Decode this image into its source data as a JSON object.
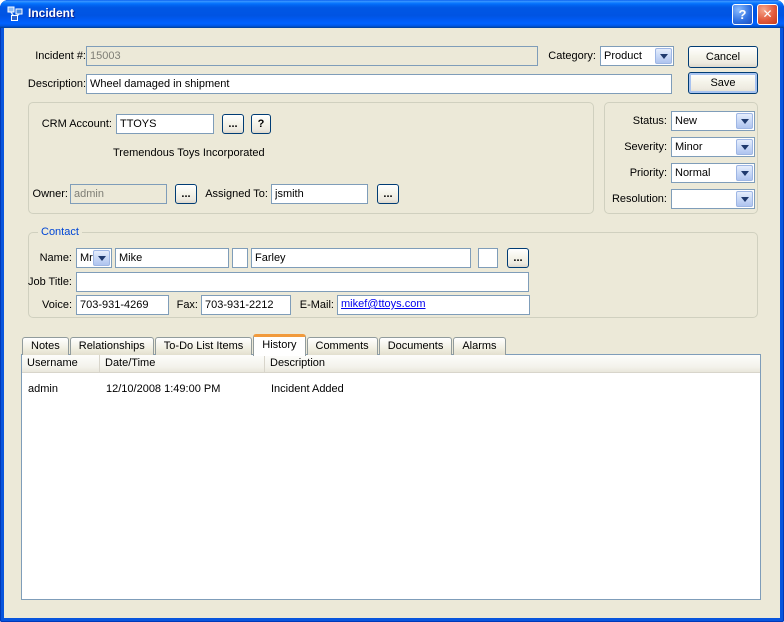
{
  "window": {
    "title": "Incident",
    "help_label": "?",
    "close_label": "✕"
  },
  "colors": {
    "titlebar_blue": "#0054E3",
    "tab_accent_orange": "#F19A3C",
    "link_blue": "#0000EE",
    "dialog_bg": "#ECE9D8"
  },
  "form": {
    "incident_label": "Incident #:",
    "incident_value": "15003",
    "category_label": "Category:",
    "category_value": "Product",
    "description_label": "Description:",
    "description_value": "Wheel damaged in shipment",
    "cancel_label": "Cancel",
    "save_label": "Save"
  },
  "crm": {
    "account_label": "CRM Account:",
    "account_value": "TTOYS",
    "browse_label": "...",
    "help_label": "?",
    "account_display_name": "Tremendous Toys Incorporated",
    "owner_label": "Owner:",
    "owner_value": "admin",
    "owner_browse_label": "...",
    "assigned_label": "Assigned To:",
    "assigned_value": "jsmith",
    "assigned_browse_label": "..."
  },
  "status_panel": {
    "status_label": "Status:",
    "status_value": "New",
    "severity_label": "Severity:",
    "severity_value": "Minor",
    "priority_label": "Priority:",
    "priority_value": "Normal",
    "resolution_label": "Resolution:",
    "resolution_value": ""
  },
  "contact": {
    "title": "Contact",
    "name_label": "Name:",
    "prefix_value": "Mr",
    "first_name_value": "Mike",
    "middle_value": "",
    "last_name_value": "Farley",
    "suffix_value": "",
    "browse_label": "...",
    "job_title_label": "Job Title:",
    "job_title_value": "",
    "voice_label": "Voice:",
    "voice_value": "703-931-4269",
    "fax_label": "Fax:",
    "fax_value": "703-931-2212",
    "email_label": "E-Mail:",
    "email_value": "mikef@ttoys.com"
  },
  "tabs": [
    {
      "label": "Notes"
    },
    {
      "label": "Relationships"
    },
    {
      "label": "To-Do List Items"
    },
    {
      "label": "History"
    },
    {
      "label": "Comments"
    },
    {
      "label": "Documents"
    },
    {
      "label": "Alarms"
    }
  ],
  "history": {
    "columns": [
      "Username",
      "Date/Time",
      "Description"
    ],
    "rows": [
      [
        "admin",
        "12/10/2008 1:49:00 PM",
        "Incident Added"
      ]
    ]
  }
}
